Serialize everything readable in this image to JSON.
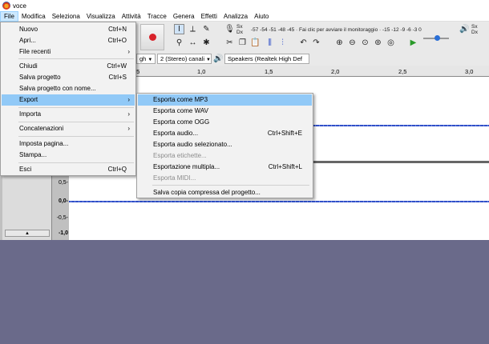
{
  "window": {
    "title": "voce"
  },
  "menubar": [
    "File",
    "Modifica",
    "Seleziona",
    "Visualizza",
    "Attività",
    "Tracce",
    "Genera",
    "Effetti",
    "Analizza",
    "Aiuto"
  ],
  "toolbar": {
    "meter_left": "Sx",
    "meter_right": "Dx",
    "meter_scale": "-57 -54 -51 -48 -45 · Fai clic per avviare il monitoraggio · -15 -12 -9 -6 -3 0",
    "meter2_left": "Sx",
    "meter2_right": "Dx",
    "input_device_tail": "gh",
    "channels": "2 (Stereo) canali",
    "output_device": "Speakers (Realtek High Def"
  },
  "ruler": {
    "ticks": [
      ".5",
      "1,0",
      "1,5",
      "2,0",
      "2,5",
      "3,0"
    ]
  },
  "track": {
    "scale": [
      "0,5-",
      "0,0-",
      "-0,5-",
      "-1,0"
    ],
    "collapse_glyph": "▲"
  },
  "file_menu": {
    "items": [
      {
        "label": "Nuovo",
        "shortcut": "Ctrl+N"
      },
      {
        "label": "Apri...",
        "shortcut": "Ctrl+O"
      },
      {
        "label": "File recenti",
        "submenu": true
      },
      {
        "label": "Chiudi",
        "shortcut": "Ctrl+W"
      },
      {
        "label": "Salva progetto",
        "shortcut": "Ctrl+S"
      },
      {
        "label": "Salva progetto con nome..."
      },
      {
        "label": "Export",
        "submenu": true,
        "highlighted": true
      },
      {
        "label": "Importa",
        "submenu": true
      },
      {
        "label": "Concatenazioni",
        "submenu": true
      },
      {
        "label": "Imposta pagina..."
      },
      {
        "label": "Stampa..."
      },
      {
        "label": "Esci",
        "shortcut": "Ctrl+Q"
      }
    ]
  },
  "export_menu": {
    "items": [
      {
        "label": "Esporta come MP3",
        "highlighted": true
      },
      {
        "label": "Esporta come WAV"
      },
      {
        "label": "Esporta come OGG"
      },
      {
        "label": "Esporta audio...",
        "shortcut": "Ctrl+Shift+E"
      },
      {
        "label": "Esporta audio selezionato..."
      },
      {
        "label": "Esporta etichette...",
        "disabled": true
      },
      {
        "label": "Esportazione multipla...",
        "shortcut": "Ctrl+Shift+L"
      },
      {
        "label": "Esporta MIDI...",
        "disabled": true
      },
      {
        "label": "Salva copia compressa del progetto..."
      }
    ]
  },
  "colors": {
    "menu_highlight": "#91c9f7",
    "waveform": "#3050c8",
    "record": "#d8222a",
    "background": "#6a6a8a"
  }
}
